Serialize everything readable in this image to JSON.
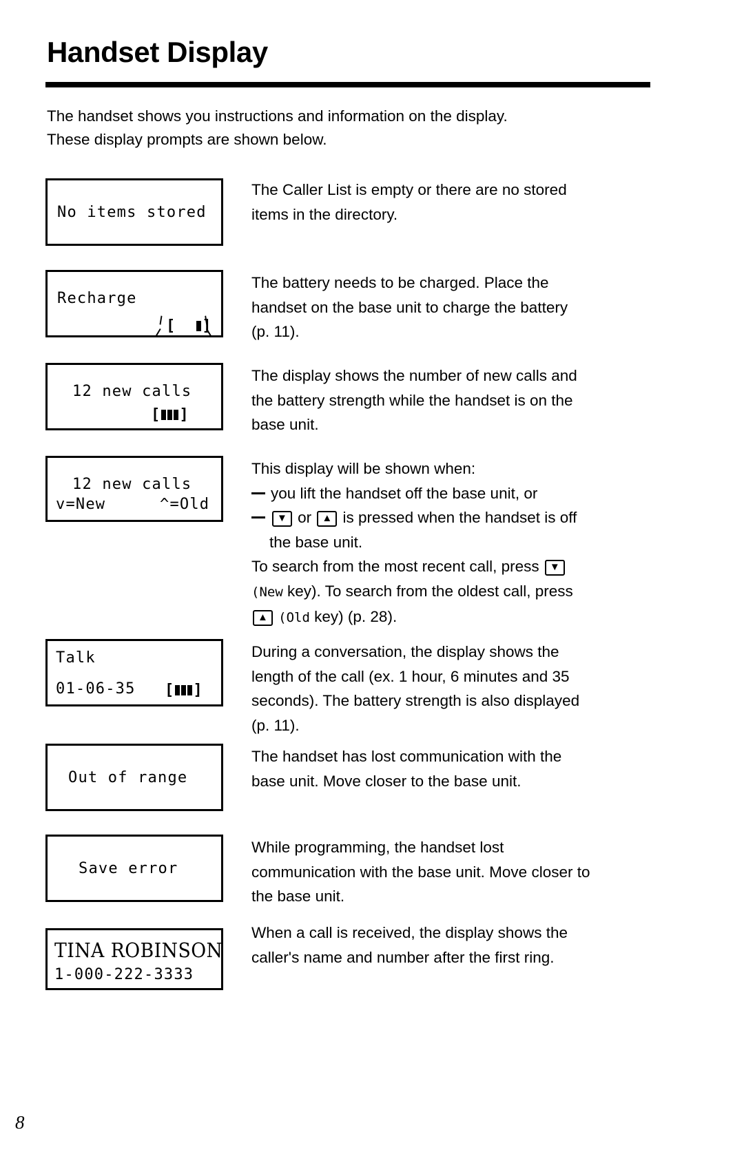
{
  "page": {
    "title": "Handset Display",
    "page_number": "8",
    "intro": [
      "The handset shows you instructions and information on the display.",
      "These display prompts are shown below."
    ]
  },
  "rows": [
    {
      "id": "no-items-stored",
      "lcd": {
        "line1": "No items stored",
        "line2": ""
      },
      "description": [
        "The Caller List is empty or there are no stored",
        "items in the directory."
      ]
    },
    {
      "id": "recharge",
      "lcd": {
        "line1": "Recharge",
        "line2_battery": "[  ▮]",
        "battery_bars": 1,
        "blinking": true
      },
      "description": [
        "The battery needs to be charged. Place the",
        "handset on the base unit to charge the battery",
        "(p. 11)."
      ]
    },
    {
      "id": "new-calls-battery",
      "lcd": {
        "line1": "12 new calls",
        "line2_battery": "[▮▮▮]",
        "battery_bars": 3,
        "blinking": false
      },
      "description": [
        "The display shows the number of new calls and",
        "the battery strength while the handset is on the",
        "base unit."
      ]
    },
    {
      "id": "new-calls-search",
      "lcd": {
        "line1": "12 new calls",
        "line2_left": "v=New",
        "line2_right": "^=Old"
      },
      "description_parts": {
        "l1": "This display will be shown when:",
        "l2_dash": "you lift the handset off the base unit, or",
        "l3_a": "or",
        "l3_b": "is pressed when the handset is off",
        "l4": "the base unit.",
        "l5": "To search from the most recent call, press",
        "l6_a": "(New",
        "l6_b": "key). To search from the oldest call, press",
        "l7_a": "(Old",
        "l7_b": "key) (p. 28).",
        "key_down": "▼",
        "key_up": "▲"
      }
    },
    {
      "id": "talk",
      "lcd": {
        "line1": "Talk",
        "line2_left": "01-06-35",
        "line2_battery": "[▮▮▮]",
        "battery_bars": 3
      },
      "description": [
        "During a conversation, the display shows the",
        "length of the call (ex. 1 hour, 6 minutes and 35",
        "seconds). The battery strength is also displayed",
        "(p. 11)."
      ]
    },
    {
      "id": "out-of-range",
      "lcd": {
        "line1": "Out of range",
        "line2": ""
      },
      "description": [
        "The handset has lost communication with the",
        "base unit. Move closer to the base unit."
      ]
    },
    {
      "id": "save-error",
      "lcd": {
        "line1": "Save error",
        "line2": ""
      },
      "description": [
        "While programming, the handset lost",
        "communication with the base unit. Move closer to",
        "the base unit."
      ]
    },
    {
      "id": "caller-id",
      "lcd": {
        "line1": "TINA ROBINSON",
        "line2": "1-000-222-3333"
      },
      "description": [
        "When a call is received, the display shows the",
        "caller's name and number after the first ring."
      ]
    }
  ]
}
